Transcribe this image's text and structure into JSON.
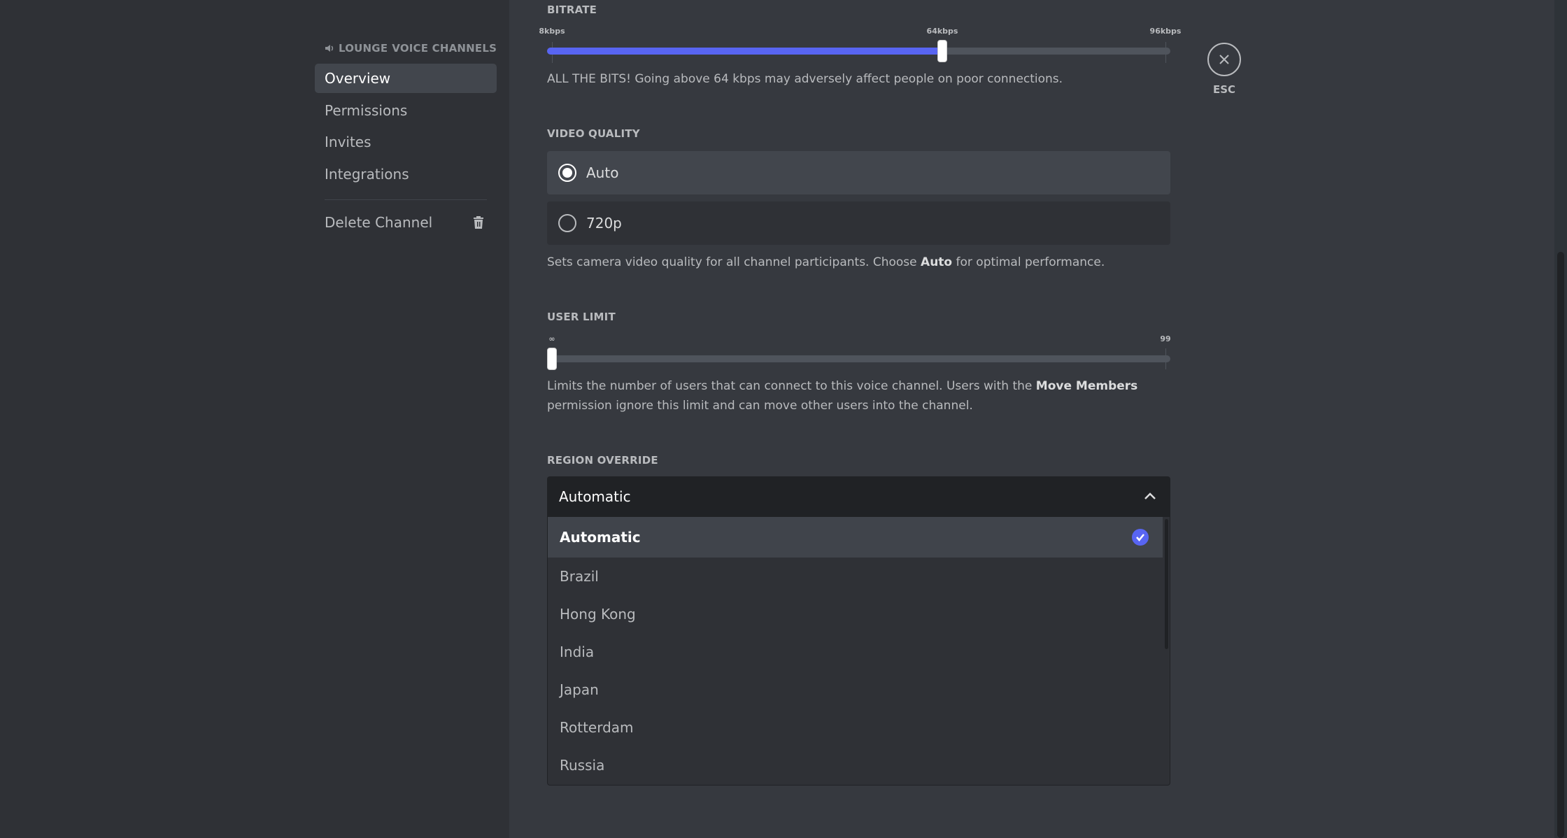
{
  "sidebar": {
    "header": {
      "icon": "speaker-icon",
      "channel": "LOUNGE",
      "category": "VOICE CHANNELS"
    },
    "items": [
      {
        "label": "Overview",
        "selected": true
      },
      {
        "label": "Permissions"
      },
      {
        "label": "Invites"
      },
      {
        "label": "Integrations"
      }
    ],
    "delete_label": "Delete Channel",
    "delete_icon": "trash-icon"
  },
  "bitrate": {
    "label": "BITRATE",
    "min_label": "8kbps",
    "mid_label": "64kbps",
    "max_label": "96kbps",
    "value_kbps": 64,
    "min": 8,
    "max": 96,
    "description": "ALL THE BITS! Going above 64 kbps may adversely affect people on poor connections."
  },
  "video_quality": {
    "label": "VIDEO QUALITY",
    "options": [
      {
        "label": "Auto",
        "selected": true
      },
      {
        "label": "720p",
        "selected": false
      }
    ],
    "description_pre": "Sets camera video quality for all channel participants. Choose ",
    "description_bold": "Auto",
    "description_post": " for optimal performance."
  },
  "user_limit": {
    "label": "USER LIMIT",
    "min_label": "∞",
    "max_label": "99",
    "value": 0,
    "description_pre": "Limits the number of users that can connect to this voice channel. Users with the ",
    "description_bold": "Move Members",
    "description_post": " permission ignore this limit and can move other users into the channel."
  },
  "region": {
    "label": "REGION OVERRIDE",
    "selected": "Automatic",
    "options": [
      "Automatic",
      "Brazil",
      "Hong Kong",
      "India",
      "Japan",
      "Rotterdam",
      "Russia"
    ]
  },
  "close": {
    "label": "ESC",
    "icon": "close-icon"
  },
  "colors": {
    "accent": "#5865f2",
    "sidebar": "#2f3136",
    "main": "#36393f"
  }
}
